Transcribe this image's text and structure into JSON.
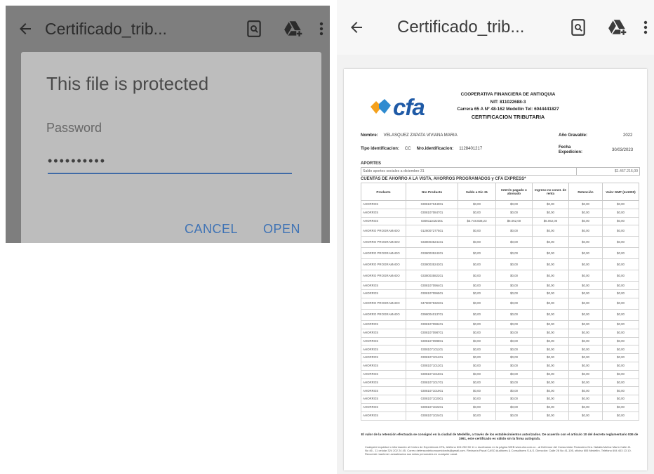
{
  "left_screen": {
    "title": "Certificado_trib...",
    "icons": {
      "back": "arrow-back-icon",
      "search": "search-in-document-icon",
      "drive": "drive-add-icon",
      "more": "more-vert-icon"
    },
    "dialog": {
      "title": "This file is protected",
      "password_label": "Password",
      "password_value": "••••••••••",
      "cancel_label": "CANCEL",
      "open_label": "OPEN"
    }
  },
  "right_screen": {
    "title": "Certificado_trib...",
    "icons": {
      "back": "arrow-back-icon",
      "search": "search-in-document-icon",
      "drive": "drive-add-icon",
      "more": "more-vert-icon"
    }
  },
  "document": {
    "logo_text": "cfa",
    "org_name": "COOPERATIVA FINANCIERA DE ANTIOQUIA",
    "nit": "NIT: 811022688-3",
    "address": "Carrera 65 A Nº 48-162 Medellín Tel: 6044441827",
    "doc_title": "CERTIFICACION TRIBUTARIA",
    "nombre_label": "Nombre:",
    "nombre_value": "VELASQUEZ ZAPATA VIVIANA MARIA",
    "anio_label": "Año Gravable:",
    "anio_value": "2022",
    "tipo_label": "Tipo identificacion:",
    "tipo_value": "CC",
    "nro_label": "Nro.identificacion:",
    "nro_value": "1128401217",
    "fecha_label": "Fecha Expedicion:",
    "fecha_value": "30/03/2023",
    "aportes_title": "APORTES",
    "aportes_desc": "Saldo aportes sociales a diciembre 31",
    "aportes_value": "$1.467.216,00",
    "cuentas_title": "CUENTAS DE AHORRO A LA VISTA, AHORROS PROGRAMADOS  y CFA EXPRESS*",
    "table": {
      "headers": [
        "Producto",
        "Nro Producto",
        "Saldo a Dic 31",
        "Interés pagado o abonado",
        "Ingreso no const. de renta",
        "Retención",
        "Valor GMF (4x1000)"
      ],
      "rows": [
        [
          "AHORROS",
          "0308107044001",
          "$0,00",
          "$0,00",
          "$0,00",
          "$0,00",
          "$0,00"
        ],
        [
          "AHORROS",
          "0308107084701",
          "$0,00",
          "$0,00",
          "$0,00",
          "$0,00",
          "$0,00"
        ],
        [
          "AHORROS",
          "0308111022301",
          "$3.748.838,23",
          "$6.062,00",
          "$6.062,00",
          "$0,00",
          "$0,00"
        ],
        [
          "AHORRO PROGRAMADO",
          "0128007277501",
          "$0,00",
          "$0,00",
          "$0,00",
          "$0,00",
          "$0,00"
        ],
        [
          "AHORRO PROGRAMADO",
          "0338003524101",
          "$0,00",
          "$0,00",
          "$0,00",
          "$0,00",
          "$0,00"
        ],
        [
          "AHORRO PROGRAMADO",
          "0338003524201",
          "$0,00",
          "$0,00",
          "$0,00",
          "$0,00",
          "$0,00"
        ],
        [
          "AHORRO PROGRAMADO",
          "0338003524301",
          "$0,00",
          "$0,00",
          "$0,00",
          "$0,00",
          "$0,00"
        ],
        [
          "AHORRO PROGRAMADO",
          "0338003582201",
          "$0,00",
          "$0,00",
          "$0,00",
          "$0,00",
          "$0,00"
        ],
        [
          "AHORROS",
          "0308107096401",
          "$0,00",
          "$0,00",
          "$0,00",
          "$0,00",
          "$0,00"
        ],
        [
          "AHORROS",
          "0308107096501",
          "$0,00",
          "$0,00",
          "$0,00",
          "$0,00",
          "$0,00"
        ],
        [
          "AHORRO PROGRAMADO",
          "0478007932301",
          "$0,00",
          "$0,00",
          "$0,00",
          "$0,00",
          "$0,00"
        ],
        [
          "AHORRO PROGRAMADO",
          "0398004013701",
          "$0,00",
          "$0,00",
          "$0,00",
          "$0,00",
          "$0,00"
        ],
        [
          "AHORROS",
          "0308107098401",
          "$0,00",
          "$0,00",
          "$0,00",
          "$0,00",
          "$0,00"
        ],
        [
          "AHORROS",
          "0308107098701",
          "$0,00",
          "$0,00",
          "$0,00",
          "$0,00",
          "$0,00"
        ],
        [
          "AHORROS",
          "0308107098801",
          "$0,00",
          "$0,00",
          "$0,00",
          "$0,00",
          "$0,00"
        ],
        [
          "AHORROS",
          "0308107101101",
          "$0,00",
          "$0,00",
          "$0,00",
          "$0,00",
          "$0,00"
        ],
        [
          "AHORROS",
          "0308107101201",
          "$0,00",
          "$0,00",
          "$0,00",
          "$0,00",
          "$0,00"
        ],
        [
          "AHORROS",
          "0308107101301",
          "$0,00",
          "$0,00",
          "$0,00",
          "$0,00",
          "$0,00"
        ],
        [
          "AHORROS",
          "0308107101501",
          "$0,00",
          "$0,00",
          "$0,00",
          "$0,00",
          "$0,00"
        ],
        [
          "AHORROS",
          "0308107101701",
          "$0,00",
          "$0,00",
          "$0,00",
          "$0,00",
          "$0,00"
        ],
        [
          "AHORROS",
          "0308107101901",
          "$0,00",
          "$0,00",
          "$0,00",
          "$0,00",
          "$0,00"
        ],
        [
          "AHORROS",
          "0308107102001",
          "$0,00",
          "$0,00",
          "$0,00",
          "$0,00",
          "$0,00"
        ],
        [
          "AHORROS",
          "0308107102201",
          "$0,00",
          "$0,00",
          "$0,00",
          "$0,00",
          "$0,00"
        ],
        [
          "AHORROS",
          "0308107102401",
          "$0,00",
          "$0,00",
          "$0,00",
          "$0,00",
          "$0,00"
        ]
      ]
    },
    "footer_note": "El valor de la retención efectuada se consignó en la ciudad de Medellín, a través de los establecimientos autorizados. De acuerdo con el artículo 10 del decreto reglamentario 836 de 1991, este certificado es válido sin la firma autógrafa.",
    "footer_contact": "Cualquier inquietud o información al Centro de Experiencia CFA, teléfono 604 250 50 11 o escríbanos en la página WEB www.cfa.com.co - al Defensor del Consumidor Financiero Dra. Natalia Muñoz Marín Calle 41 No 46 - 11 celular 324 202 24 45. Correo defensordelconsumidorcfa@gmail.com. Revisoría Fiscal CASO Auditores & Consultores S.A.S. Dirección: Calle 28 No 41-105, oficina 605 Medellín. Teléfono 604 403 13 10. Recuerde mantener actualizados sus datos personales en cualquier canal."
  }
}
